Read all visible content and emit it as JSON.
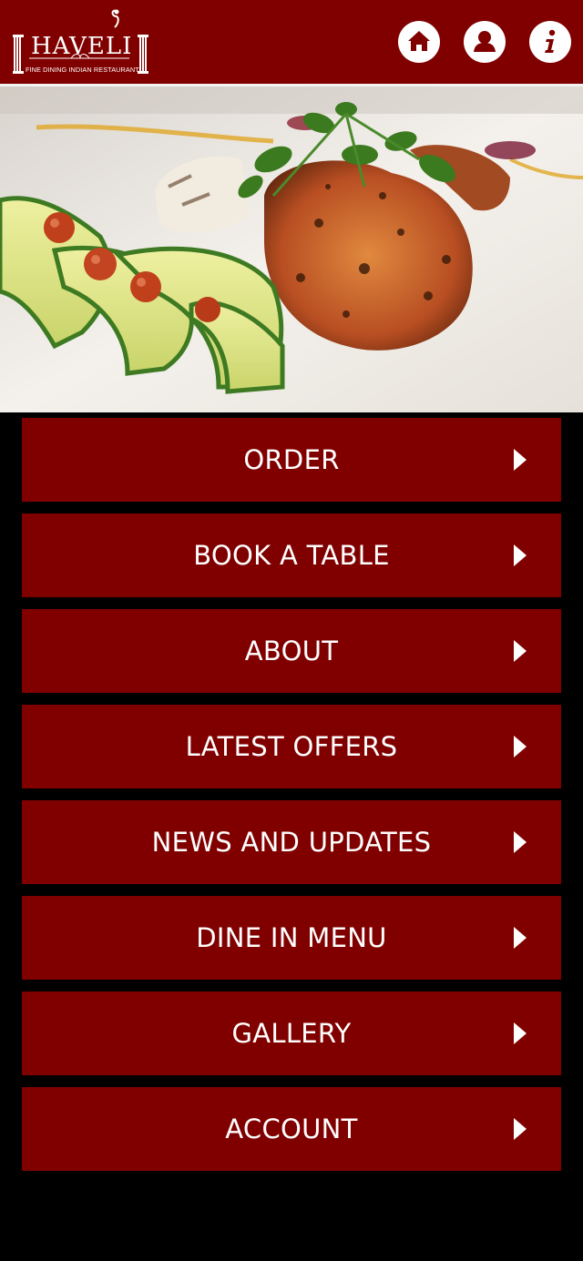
{
  "header": {
    "logo": {
      "name": "HAVELI",
      "tagline": "FINE DINING INDIAN RESTAURANT"
    },
    "icons": [
      {
        "name": "home-icon"
      },
      {
        "name": "user-icon"
      },
      {
        "name": "info-icon"
      }
    ]
  },
  "hero": {
    "image": "plated tandoori dish with cucumber ribbons, cherry tomatoes and coriander"
  },
  "menu": {
    "items": [
      {
        "label": "ORDER"
      },
      {
        "label": "BOOK A TABLE"
      },
      {
        "label": "ABOUT"
      },
      {
        "label": "LATEST OFFERS"
      },
      {
        "label": "NEWS AND UPDATES"
      },
      {
        "label": "DINE IN MENU"
      },
      {
        "label": "GALLERY"
      },
      {
        "label": "ACCOUNT"
      }
    ],
    "arrow_icon": "chevron-right-icon"
  },
  "colors": {
    "brand": "#800000",
    "background": "#000000",
    "text": "#ffffff"
  }
}
